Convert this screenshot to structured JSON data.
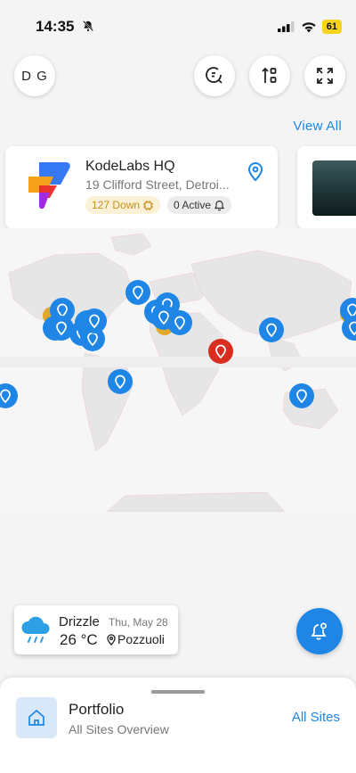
{
  "status_bar": {
    "time": "14:35",
    "battery": "61"
  },
  "header": {
    "avatar_initials": "D G"
  },
  "view_all_label": "View All",
  "site_card": {
    "title": "KodeLabs HQ",
    "address": "19 Clifford Street, Detroi...",
    "down_badge": "127 Down",
    "active_badge": "0 Active"
  },
  "weather": {
    "condition": "Drizzle",
    "temperature": "26 °C",
    "date": "Thu, May 28",
    "location": "Pozzuoli"
  },
  "bottom_sheet": {
    "title": "Portfolio",
    "subtitle": "All Sites Overview",
    "action": "All Sites"
  },
  "colors": {
    "accent": "#1f86e6",
    "alert_pin": "#d92d20",
    "down_text": "#c98e1a",
    "down_bg": "#fbf1d6"
  }
}
